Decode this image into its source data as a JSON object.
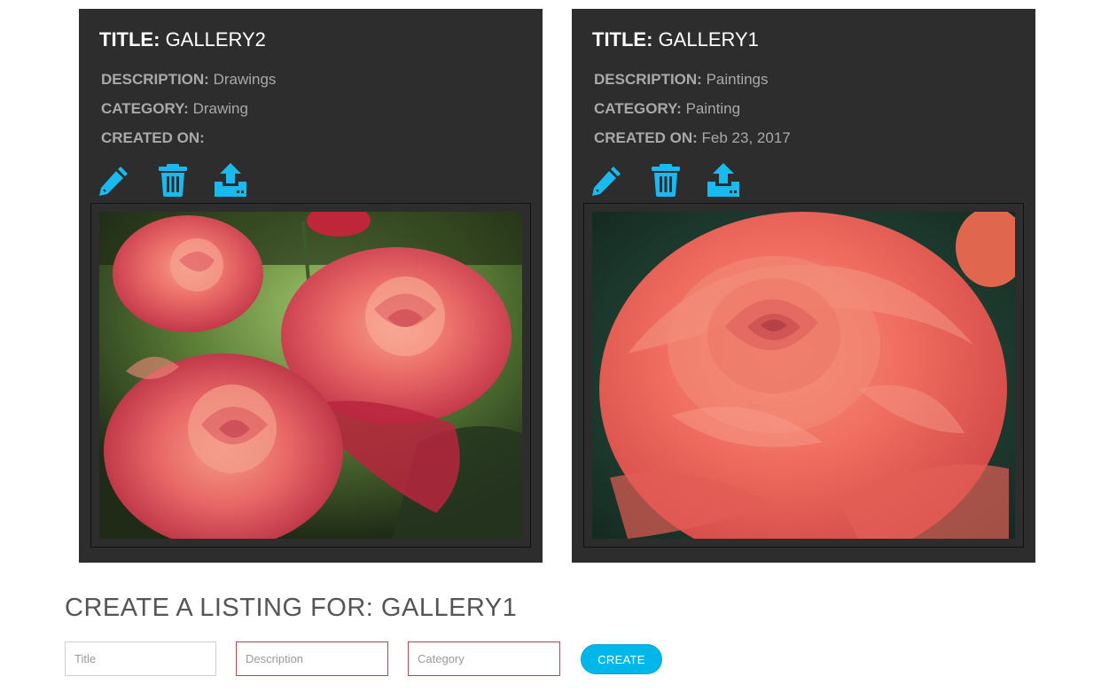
{
  "accent_color": "#00b7ea",
  "galleries": [
    {
      "title_label": "TITLE:",
      "title_value": "GALLERY2",
      "description_label": "DESCRIPTION:",
      "description_value": "Drawings",
      "category_label": "CATEGORY:",
      "category_value": "Drawing",
      "created_label": "CREATED ON:",
      "created_value": "",
      "icons": [
        "pencil-icon",
        "trash-icon",
        "upload-icon"
      ],
      "image": "red roses cluster photo"
    },
    {
      "title_label": "TITLE:",
      "title_value": "GALLERY1",
      "description_label": "DESCRIPTION:",
      "description_value": "Paintings",
      "category_label": "CATEGORY:",
      "category_value": "Painting",
      "created_label": "CREATED ON:",
      "created_value": "Feb 23, 2017",
      "icons": [
        "pencil-icon",
        "trash-icon",
        "upload-icon"
      ],
      "image": "single coral rose photo"
    }
  ],
  "create_listing": {
    "heading": "CREATE A LISTING FOR: GALLERY1",
    "title_placeholder": "Title",
    "description_placeholder": "Description",
    "category_placeholder": "Category",
    "button_label": "CREATE"
  }
}
